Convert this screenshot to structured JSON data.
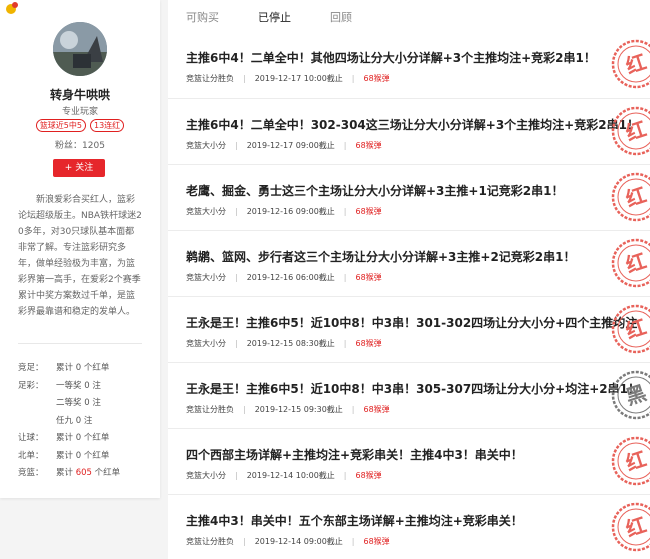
{
  "profile": {
    "name": "转身牛哄哄",
    "role": "专业玩家",
    "badges": [
      "篮球近5中5",
      "13连红"
    ],
    "fans": "粉丝：1205",
    "follow_label": "+ 关注",
    "bio": "新浪爱彩合买红人，篮彩论坛超级版主。NBA铁杆球迷20多年，对30只球队基本面都非常了解。专注篮彩研究多年，做单经验极为丰富，为篮彩界第一高手，在爱彩2个赛季累计中奖方案数过千单，是篮彩界最靠谱和稳定的发单人。"
  },
  "records": [
    {
      "key": "竞足：",
      "pre": "累计",
      "value": "0",
      "post": "个红单",
      "highlight": false
    },
    {
      "key": "足彩：",
      "pre": "一等奖",
      "value": "0",
      "post": "注",
      "highlight": false
    },
    {
      "key": "",
      "pre": "二等奖",
      "value": "0",
      "post": "注",
      "highlight": false
    },
    {
      "key": "",
      "pre": "任九",
      "value": "0",
      "post": "注",
      "highlight": false
    },
    {
      "key": "让球：",
      "pre": "累计",
      "value": "0",
      "post": "个红单",
      "highlight": false
    },
    {
      "key": "北单：",
      "pre": "累计",
      "value": "0",
      "post": "个红单",
      "highlight": false
    },
    {
      "key": "竞篮：",
      "pre": "累计",
      "value": "605",
      "post": "个红单",
      "highlight": true
    }
  ],
  "tabs": [
    {
      "label": "可购买",
      "active": false
    },
    {
      "label": "已停止",
      "active": true
    },
    {
      "label": "回顾",
      "active": false
    }
  ],
  "items": [
    {
      "title": "主推6中4！二单全中！其他四场让分大小分详解+3个主推均注+竞彩2串1！",
      "category": "竞篮让分胜负",
      "time": "2019-12-17 10:00截止",
      "price": "68猴弹",
      "stamp": "红",
      "stamp_color": "#e8625a"
    },
    {
      "title": "主推6中4！二单全中！302-304这三场让分大小分详解+3个主推均注+竞彩2串1！",
      "category": "竞篮大小分",
      "time": "2019-12-17 09:00截止",
      "price": "68猴弹",
      "stamp": "红",
      "stamp_color": "#e8625a"
    },
    {
      "title": "老鹰、掘金、勇士这三个主场让分大小分详解+3主推+1记竞彩2串1！",
      "category": "竞篮大小分",
      "time": "2019-12-16 09:00截止",
      "price": "68猴弹",
      "stamp": "红",
      "stamp_color": "#e8625a"
    },
    {
      "title": "鹈鹕、篮网、步行者这三个主场让分大小分详解+3主推+2记竞彩2串1！",
      "category": "竞篮大小分",
      "time": "2019-12-16 06:00截止",
      "price": "68猴弹",
      "stamp": "红",
      "stamp_color": "#e8625a"
    },
    {
      "title": "王永是王！主推6中5！近10中8！中3串！301-302四场让分大小分+四个主推均注",
      "category": "竞篮大小分",
      "time": "2019-12-15 08:30截止",
      "price": "68猴弹",
      "stamp": "红",
      "stamp_color": "#e8625a"
    },
    {
      "title": "王永是王！主推6中5！近10中8！中3串！305-307四场让分大小分+均注+2串1！",
      "category": "竞篮让分胜负",
      "time": "2019-12-15 09:30截止",
      "price": "68猴弹",
      "stamp": "黑",
      "stamp_color": "#7a7a7a"
    },
    {
      "title": "四个西部主场详解+主推均注+竞彩串关！主推4中3！串关中！",
      "category": "竞篮大小分",
      "time": "2019-12-14 10:00截止",
      "price": "68猴弹",
      "stamp": "红",
      "stamp_color": "#e8625a"
    },
    {
      "title": "主推4中3！串关中！五个东部主场详解+主推均注+竞彩串关！",
      "category": "竞篮让分胜负",
      "time": "2019-12-14 09:00截止",
      "price": "68猴弹",
      "stamp": "红",
      "stamp_color": "#e8625a"
    }
  ]
}
